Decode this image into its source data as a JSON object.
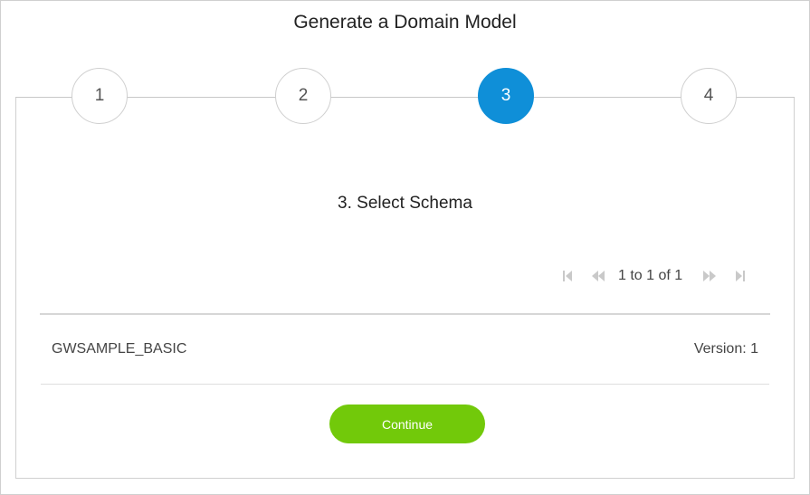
{
  "header": {
    "title": "Generate a Domain Model"
  },
  "wizard": {
    "steps": [
      {
        "label": "1",
        "active": false
      },
      {
        "label": "2",
        "active": false
      },
      {
        "label": "3",
        "active": true
      },
      {
        "label": "4",
        "active": false
      }
    ],
    "active_color": "#0f8fd8"
  },
  "main": {
    "subtitle": "3. Select Schema",
    "pager": {
      "text": "1 to 1 of 1",
      "icons": [
        "first-page-icon",
        "previous-page-icon",
        "next-page-icon",
        "last-page-icon"
      ]
    },
    "schemas": [
      {
        "name": "GWSAMPLE_BASIC",
        "version": "Version: 1"
      }
    ],
    "continue_label": "Continue",
    "continue_color": "#72c90a"
  }
}
